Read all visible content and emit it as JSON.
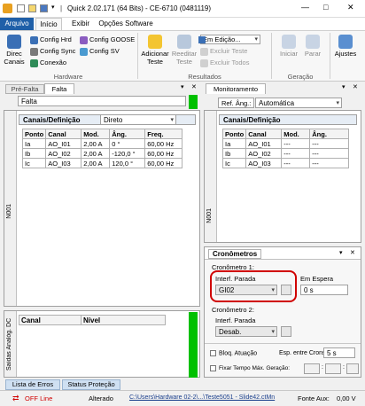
{
  "window": {
    "title": "Quick 2.02.171 (64 Bits) - CE-6710 (0481119)",
    "minimize": "—",
    "maximize": "□",
    "close": "✕"
  },
  "tabs": [
    "Arquivo",
    "Início",
    "Exibir",
    "Opções Software"
  ],
  "ribbon": {
    "direc": [
      "Direc",
      "Canais"
    ],
    "config_hrd": "Config Hrd",
    "config_goose": "Config GOOSE",
    "config_sync": "Config Sync",
    "config_sv": "Config SV",
    "conexao": "Conexão",
    "hardware_group": "Hardware",
    "adicionar": [
      "Adicionar",
      "Teste"
    ],
    "reeditar": [
      "Reeditar",
      "Teste"
    ],
    "em_edicao": "Em Edição...",
    "excluir_teste": "Excluir Teste",
    "excluir_todos": "Excluir Todos",
    "resultados_group": "Resultados",
    "iniciar": "Iniciar",
    "parar": "Parar",
    "geracao_group": "Geração",
    "ajustes": "Ajustes"
  },
  "left_panel": {
    "tabs": [
      "Pré-Falta",
      "Falta"
    ],
    "field": "Falta",
    "table_title": "Canais/Definição",
    "mode": "Direto",
    "columns": [
      "Ponto",
      "Canal",
      "Mod.",
      "Âng.",
      "Freq."
    ],
    "rows": [
      [
        "Ia",
        "AO_I01",
        "2,00 A",
        "0 °",
        "60,00 Hz"
      ],
      [
        "Ib",
        "AO_I02",
        "2,00 A",
        "-120,0 °",
        "60,00 Hz"
      ],
      [
        "Ic",
        "AO_I03",
        "2,00 A",
        "120,0 °",
        "60,00 Hz"
      ]
    ],
    "side_label": "N001",
    "bottom_columns": [
      "Canal",
      "Nível"
    ],
    "bottom_side": "Saídas Analóg. DC"
  },
  "right_panel": {
    "title": "Monitoramento",
    "ref_label": "Ref. Âng.:",
    "ref_value": "Automática",
    "table_title": "Canais/Definição",
    "columns": [
      "Ponto",
      "Canal",
      "Mod.",
      "Âng."
    ],
    "rows": [
      [
        "Ia",
        "AO_I01",
        "---",
        "---"
      ],
      [
        "Ib",
        "AO_I02",
        "---",
        "---"
      ],
      [
        "Ic",
        "AO_I03",
        "---",
        "---"
      ]
    ],
    "side_label": "N001"
  },
  "cronometros": {
    "title": "Cronômetros",
    "c1_label": "Cronômetro 1:",
    "interf_label": "Interf. Parada",
    "interf_value": "GI02",
    "espera_label": "Em Espera",
    "espera_value": "0 s",
    "c2_label": "Cronômetro 2:",
    "interf2_label": "Interf. Parada",
    "interf2_value": "Desab.",
    "bloq_label": "Bloq. Atuação",
    "esp_label": "Esp. entre Crons.:",
    "esp_value": "5 s",
    "fixar_label": "Fixar Tempo Máx. Geração:",
    "fixar_sep": ":"
  },
  "bottom_tabs": [
    "Lista de Erros",
    "Status Proteção"
  ],
  "status": {
    "off": "OFF Line",
    "altered": "Alterado",
    "path": "C:\\Users\\Hardware 02-2\\...\\Teste5051 - Slide42.ctMn",
    "fonte_label": "Fonte Aux:",
    "fonte_value": "0,00 V"
  },
  "colors": {
    "highlight": "#d00000",
    "accent": "#1f5fa8",
    "green": "#00c000"
  }
}
